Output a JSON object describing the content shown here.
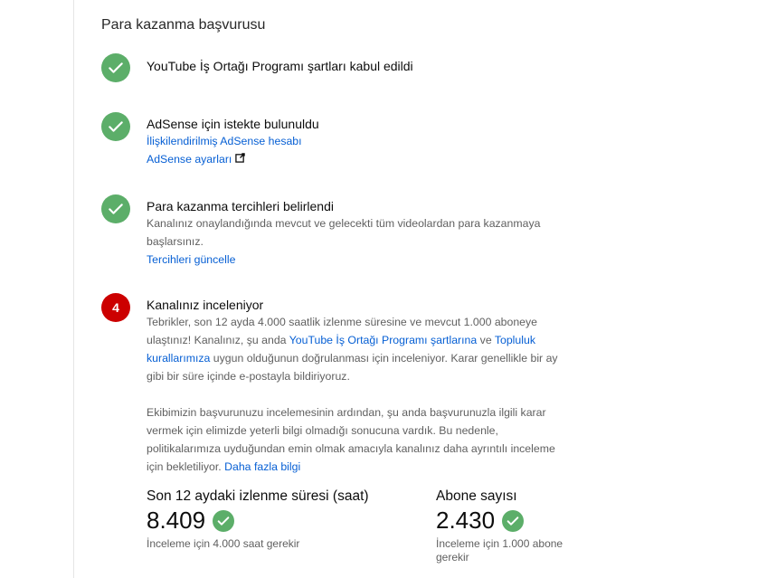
{
  "title": "Para kazanma başvurusu",
  "steps": {
    "s1": {
      "heading": "YouTube İş Ortağı Programı şartları kabul edildi"
    },
    "s2": {
      "heading": "AdSense için istekte bulunuldu",
      "link1": "İlişkilendirilmiş AdSense hesabı",
      "link2": "AdSense ayarları"
    },
    "s3": {
      "heading": "Para kazanma tercihleri belirlendi",
      "desc": "Kanalınız onaylandığında mevcut ve gelecekti tüm videolardan para kazanmaya başlarsınız.",
      "link": "Tercihleri güncelle"
    },
    "s4": {
      "badge": "4",
      "heading": "Kanalınız inceleniyor",
      "p1_a": "Tebrikler, son 12 ayda 4.000 saatlik izlenme süresine ve mevcut 1.000 aboneye ulaştınız! Kanalınız, şu anda ",
      "p1_link1": "YouTube İş Ortağı Programı şartlarına",
      "p1_b": " ve ",
      "p1_link2": "Topluluk kurallarımıza",
      "p1_c": " uygun olduğunun doğrulanması için inceleniyor. Karar genellikle bir ay gibi bir süre içinde e-postayla bildiriyoruz.",
      "p2_a": "Ekibimizin başvurunuzu incelemesinin ardından, şu anda başvurunuzla ilgili karar vermek için elimizde yeterli bilgi olmadığı sonucuna vardık. Bu nedenle, politikalarımıza uyduğundan emin olmak amacıyla kanalınız daha ayrıntılı inceleme için bekletiliyor. ",
      "p2_link": "Daha fazla bilgi"
    }
  },
  "stats": {
    "watch": {
      "label": "Son 12 aydaki izlenme süresi (saat)",
      "value": "8.409",
      "note": "İnceleme için 4.000 saat gerekir"
    },
    "subs": {
      "label": "Abone sayısı",
      "value": "2.430",
      "note": "İnceleme için 1.000 abone gerekir"
    }
  },
  "colors": {
    "success": "#5cae69",
    "alert": "#cc0000",
    "link": "#065fd4"
  },
  "icons": {
    "done": "check-icon",
    "external": "external-link-icon"
  }
}
